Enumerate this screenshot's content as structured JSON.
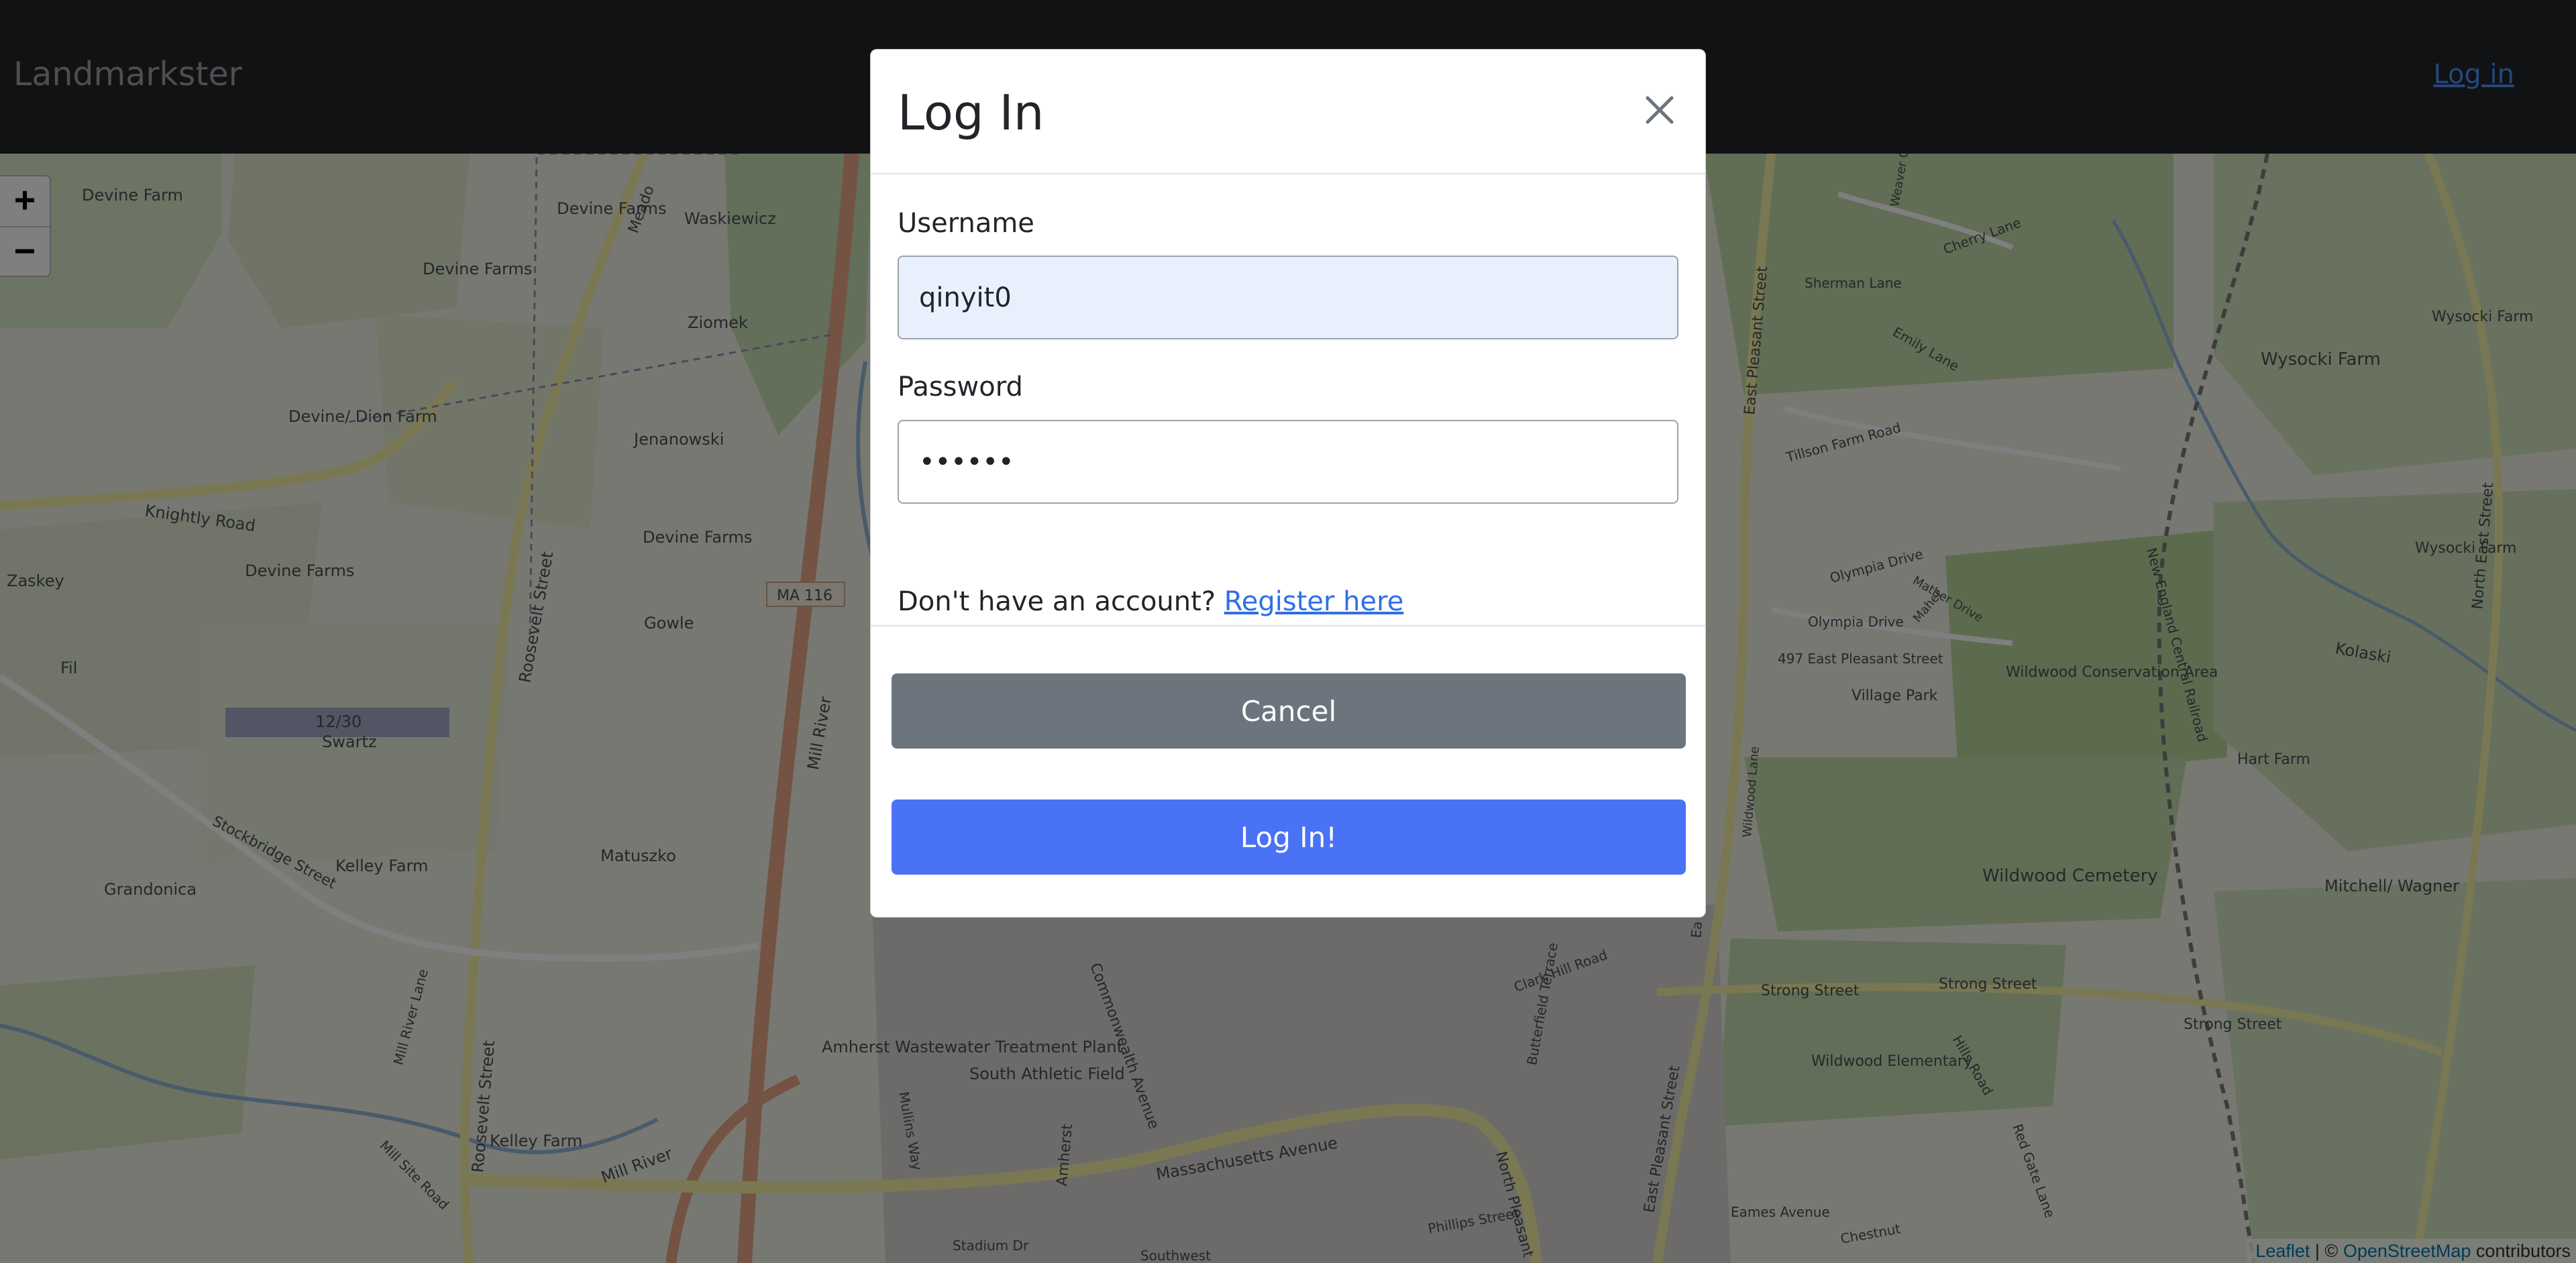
{
  "navbar": {
    "brand": "Landmarkster",
    "login_link": "Log in"
  },
  "map": {
    "zoom_in": "+",
    "zoom_out": "−",
    "attribution": {
      "leaflet": "Leaflet",
      "separator": " | © ",
      "osm": "OpenStreetMap",
      "suffix": " contributors"
    },
    "labels": {
      "devine_farm": "Devine Farm",
      "devine_farms_1": "Devine Farms",
      "devine_farms_2": "Devine Farms",
      "devine_farms_3": "Devine Farms",
      "devine_farms_4": "Devine Farms",
      "waskiewicz": "Waskiewicz",
      "ziomek": "Ziomek",
      "devine_dion": "Devine/ Dion Farm",
      "jenanowski": "Jenanowski",
      "knightly": "Knightly Road",
      "zaskey": "Zaskey",
      "gowle": "Gowle",
      "fil": "Fil",
      "ma116": "MA 116",
      "runway": "12/30",
      "swartz": "Swartz",
      "roosevelt_1": "Roosevelt Street",
      "roosevelt_2": "Roosevelt Street",
      "stockbridge": "Stockbridge Street",
      "kelley_farm_1": "Kelley Farm",
      "kelley_farm_2": "Kelley Farm",
      "grandonica": "Grandonica",
      "matuszko": "Matuszko",
      "mill_river_lane": "Mill River Lane",
      "mill_site_road": "Mill Site Road",
      "mill_river": "Mill River",
      "mill_river_2": "Mill River",
      "amherst_wwtp": "Amherst Wastewater Treatment Plant",
      "mullins_way": "Mullins Way",
      "south_athletic": "South Athletic Field",
      "commonwealth": "Commonwealth Avenue",
      "massachusetts": "Massachusetts Avenue",
      "amherst": "Amherst",
      "stadium": "Stadium Dr",
      "southwest": "Southwest",
      "phillips": "Phillips Street",
      "north_pleasant": "North Pleasant",
      "butterfield": "Butterfield Terrace",
      "clark_hill": "Clark Hill Road",
      "east_pleasant_1": "East Pleasant Street",
      "east_pleasant_2": "East Pleasant Street",
      "east_pleasant_3": "Ea",
      "eames": "Eames Avenue",
      "sherman": "Sherman Lane",
      "emily": "Emily Lane",
      "cherry": "Cherry Lane",
      "weaver": "Weaver Ci",
      "tillson": "Tillson Farm Road",
      "olympia_1": "Olympia Drive",
      "olympia_2": "Olympia Drive",
      "mather": "Mather Drive",
      "maher": "Maher",
      "pleasant_497": "497 East Pleasant Street",
      "village_park": "Village Park",
      "wildwood_cons": "Wildwood Conservation Area",
      "new_england": "New England Central Railroad",
      "wildwood_lane": "Wildwood Lane",
      "wildwood_cem": "Wildwood Cemetery",
      "strong_1": "Strong Street",
      "strong_2": "Strong Street",
      "strong_3": "Strong Street",
      "hills_road": "Hills Road",
      "wildwood_elem": "Wildwood Elementary",
      "red_gate": "Red Gate Lane",
      "chestnut": "Chestnut",
      "wysocki_1": "Wysocki Farm",
      "wysocki_2": "Wysocki Farm",
      "wysocki_3": "Wysocki Farm",
      "north_east": "North East Street",
      "kolaski": "Kolaski",
      "hart_farm": "Hart Farm",
      "mitchell": "Mitchell/ Wagner",
      "meadow": "Meado"
    }
  },
  "modal": {
    "title": "Log In",
    "username_label": "Username",
    "username_value": "qinyit0",
    "password_label": "Password",
    "password_value": "••••••",
    "register_prompt": "Don't have an account?",
    "register_link": "Register here",
    "cancel_button": "Cancel",
    "login_button": "Log In!"
  }
}
